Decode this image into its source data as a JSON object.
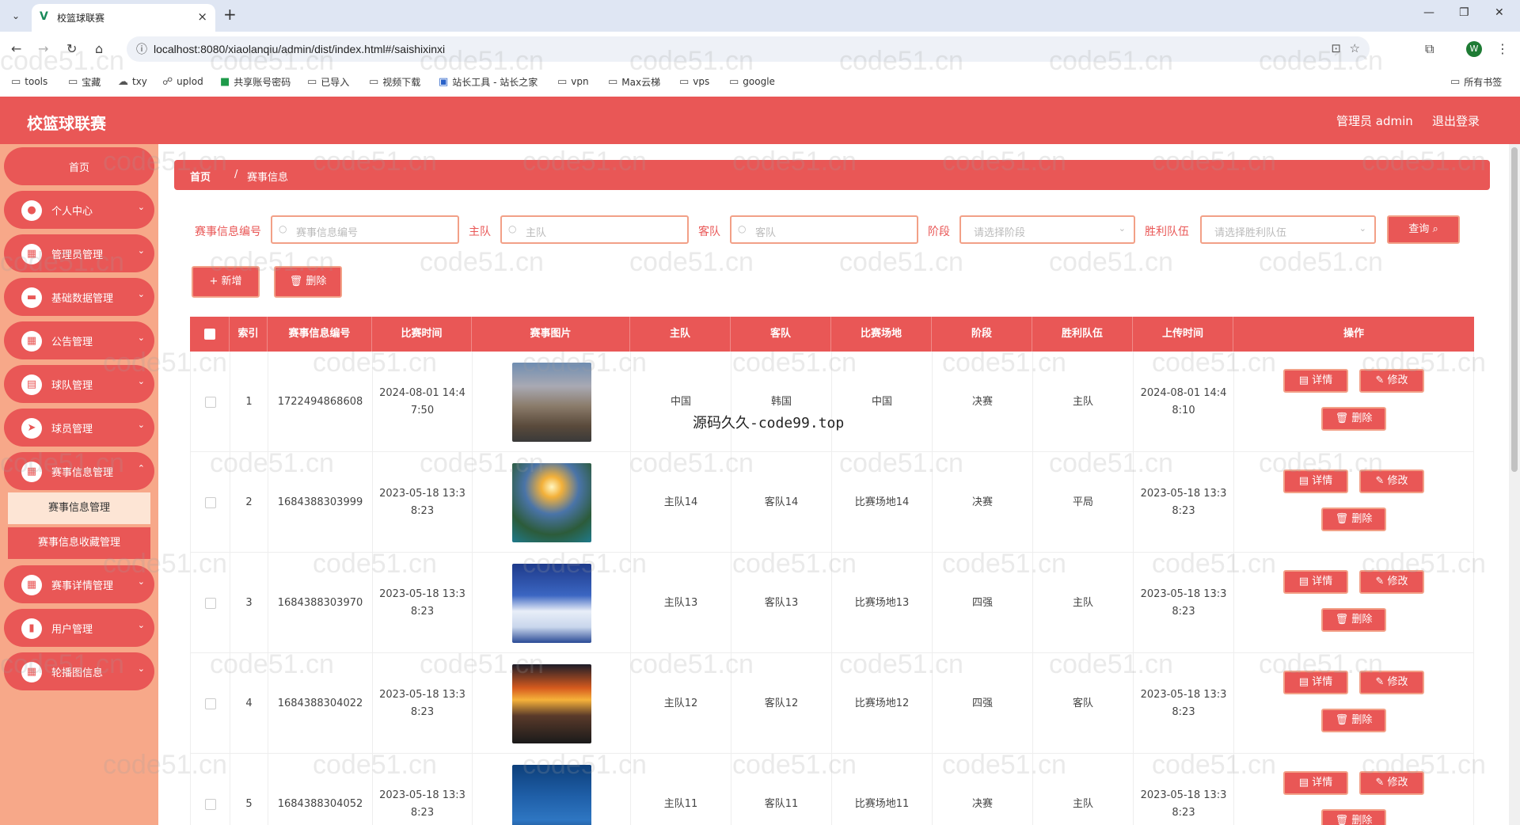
{
  "browser": {
    "tab_title": "校篮球联赛",
    "url": "localhost:8080/xiaolanqiu/admin/dist/index.html#/saishixinxi",
    "profile_initial": "W",
    "bookmarks": [
      "tools",
      "宝藏",
      "txy",
      "uplod",
      "共享账号密码",
      "已导入",
      "视频下载",
      "站长工具 - 站长之家",
      "vpn",
      "Max云梯",
      "vps",
      "google"
    ],
    "all_bookmarks": "所有书签"
  },
  "header": {
    "app_name": "校篮球联赛",
    "admin_label": "管理员 admin",
    "logout_label": "退出登录"
  },
  "sidebar": {
    "home": "首页",
    "items": [
      "个人中心",
      "管理员管理",
      "基础数据管理",
      "公告管理",
      "球队管理",
      "球员管理",
      "赛事信息管理",
      "赛事详情管理",
      "用户管理",
      "轮播图信息"
    ],
    "sub_items": [
      "赛事信息管理",
      "赛事信息收藏管理"
    ]
  },
  "breadcrumb": {
    "home": "首页",
    "separator": "/",
    "current": "赛事信息"
  },
  "filters": {
    "id_label": "赛事信息编号",
    "id_placeholder": "赛事信息编号",
    "home_label": "主队",
    "home_placeholder": "主队",
    "away_label": "客队",
    "away_placeholder": "客队",
    "stage_label": "阶段",
    "stage_placeholder": "请选择阶段",
    "winner_label": "胜利队伍",
    "winner_placeholder": "请选择胜利队伍",
    "search_button": "查询"
  },
  "toolbar": {
    "add_button": "+ 新增",
    "delete_button": "删除"
  },
  "table": {
    "headers": [
      "索引",
      "赛事信息编号",
      "比赛时间",
      "赛事图片",
      "主队",
      "客队",
      "比赛场地",
      "阶段",
      "胜利队伍",
      "上传时间",
      "操作"
    ],
    "rows": [
      {
        "index": "1",
        "code": "1722494868608",
        "time_a": "2024-08-01 14:4",
        "time_b": "7:50",
        "home": "中国",
        "away": "韩国",
        "venue": "中国",
        "stage": "决赛",
        "winner": "主队",
        "up_a": "2024-08-01 14:4",
        "up_b": "8:10"
      },
      {
        "index": "2",
        "code": "1684388303999",
        "time_a": "2023-05-18 13:3",
        "time_b": "8:23",
        "home": "主队14",
        "away": "客队14",
        "venue": "比赛场地14",
        "stage": "决赛",
        "winner": "平局",
        "up_a": "2023-05-18 13:3",
        "up_b": "8:23"
      },
      {
        "index": "3",
        "code": "1684388303970",
        "time_a": "2023-05-18 13:3",
        "time_b": "8:23",
        "home": "主队13",
        "away": "客队13",
        "venue": "比赛场地13",
        "stage": "四强",
        "winner": "主队",
        "up_a": "2023-05-18 13:3",
        "up_b": "8:23"
      },
      {
        "index": "4",
        "code": "1684388304022",
        "time_a": "2023-05-18 13:3",
        "time_b": "8:23",
        "home": "主队12",
        "away": "客队12",
        "venue": "比赛场地12",
        "stage": "四强",
        "winner": "客队",
        "up_a": "2023-05-18 13:3",
        "up_b": "8:23"
      },
      {
        "index": "5",
        "code": "1684388304052",
        "time_a": "2023-05-18 13:3",
        "time_b": "8:23",
        "home": "主队11",
        "away": "客队11",
        "venue": "比赛场地11",
        "stage": "决赛",
        "winner": "主队",
        "up_a": "2023-05-18 13:3",
        "up_b": "8:23"
      }
    ],
    "detail_button": "详情",
    "edit_button": "修改",
    "delete_button": "删除"
  },
  "watermark": "code51.cn",
  "overlay_text": "源码久久-code99.top",
  "colors": {
    "primary": "#e95756",
    "sidebar_bg": "#f7a889",
    "border": "#f2a087"
  }
}
